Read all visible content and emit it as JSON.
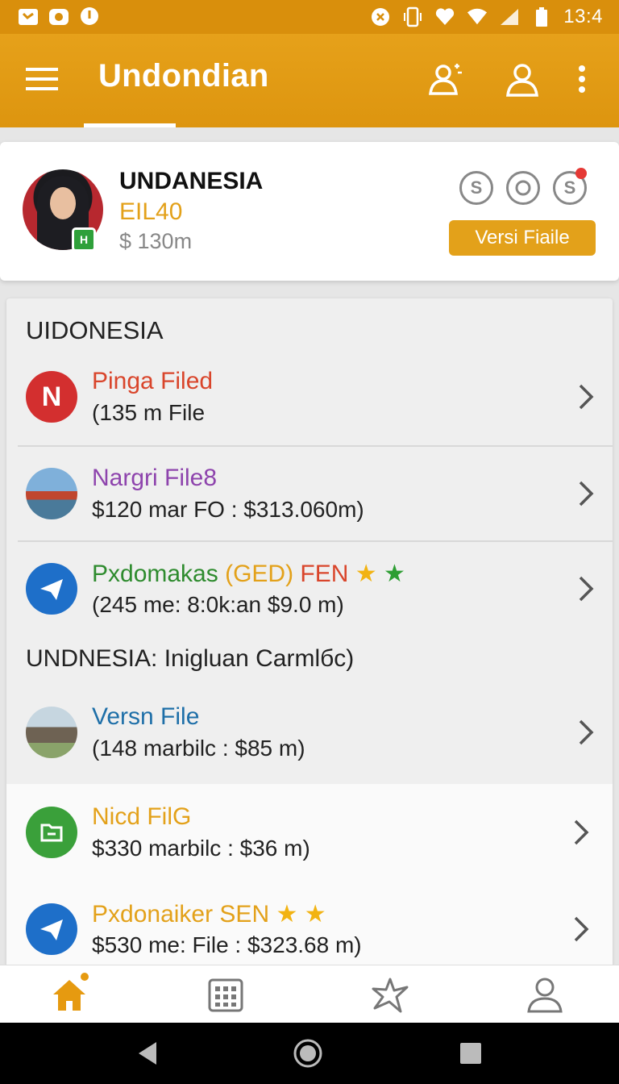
{
  "status_bar": {
    "time": "13:4",
    "left_icons": [
      "notification-icon",
      "map-icon",
      "location-icon"
    ],
    "right_icons": [
      "alarm-icon",
      "vibrate-icon",
      "heart-icon",
      "wifi-icon",
      "signal-icon",
      "battery-icon"
    ]
  },
  "app_bar": {
    "title": "Undondian",
    "actions": [
      "contacts-icon",
      "account-icon",
      "more-vert-icon"
    ]
  },
  "profile": {
    "name": "UNDANESIA",
    "code": "EIL40",
    "amount": "$ 130m",
    "badge": "H",
    "icons": [
      "coin-s-icon",
      "target-icon",
      "coin-alert-icon"
    ],
    "button_label": "Versi Fiaile"
  },
  "sections": [
    {
      "header": "UIDONESIA",
      "items": [
        {
          "title": "Pinga Filed",
          "subtitle": "(135 m File",
          "title_color": "#d9452b",
          "icon_label": "N",
          "icon_bg": "#d32f2f"
        },
        {
          "title": "Nargri File8",
          "subtitle": "$120 mar FO : $313.060m)",
          "title_color": "#8e44ad",
          "icon_label": "",
          "icon_bg": "#6a9bc7"
        },
        {
          "title_parts": [
            "Pxdomakas ",
            "(GED) ",
            "FEN "
          ],
          "subtitle": "(245 me: 8:0k:an $9.0 m)",
          "title_colors": [
            "#2e8b2e",
            "#e3a11a",
            "#d9452b"
          ],
          "stars": [
            "★",
            "★"
          ],
          "icon_bg": "#1e6fc9"
        }
      ]
    },
    {
      "header": "UNDNESIA: Inigluan Carmlбc)",
      "items": [
        {
          "title": "Versn File",
          "subtitle": "(148 marbilc : $85 m)",
          "title_color": "#1e6fa8",
          "icon_bg": "#9a8f7a"
        },
        {
          "title": "Nicd FilG",
          "subtitle": "$330 marbilc : $36 m)",
          "title_color": "#e3a11a",
          "icon_bg": "#3aa03a"
        },
        {
          "title": "Pxdonaiker SEN ",
          "subtitle": "$530 me: File : $323.68 m)",
          "title_color": "#e3a11a",
          "stars": [
            "★",
            "★"
          ],
          "icon_bg": "#1e6fc9"
        }
      ]
    }
  ],
  "bottom_nav": [
    "home-icon",
    "calendar-icon",
    "star-icon",
    "person-icon"
  ],
  "system_nav": [
    "back-icon",
    "home-button-icon",
    "recents-icon"
  ]
}
